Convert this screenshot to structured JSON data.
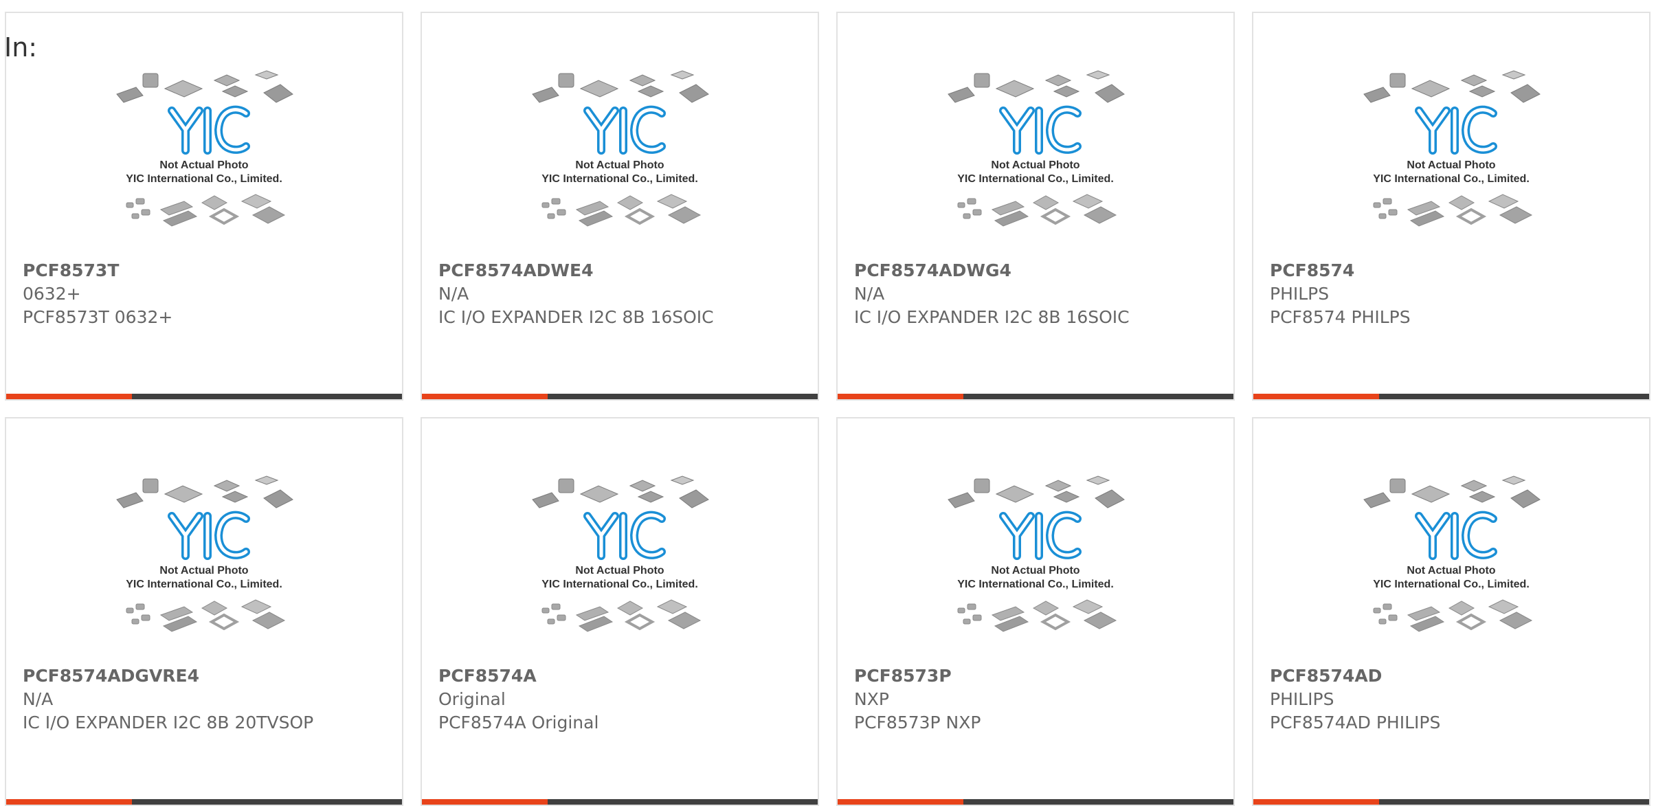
{
  "heading": "In:",
  "colors": {
    "accent": "#e8431a",
    "bar": "#404040",
    "logo": "#1a8fd6",
    "text": "#666666"
  },
  "placeholder": {
    "line1": "Not Actual Photo",
    "line2": "YIC International Co., Limited.",
    "logo_text": "YIC"
  },
  "products": [
    {
      "part": "PCF8573T",
      "brand": "0632+",
      "desc": "PCF8573T 0632+"
    },
    {
      "part": "PCF8574ADWE4",
      "brand": "N/A",
      "desc": "IC I/O EXPANDER I2C 8B 16SOIC"
    },
    {
      "part": "PCF8574ADWG4",
      "brand": "N/A",
      "desc": "IC I/O EXPANDER I2C 8B 16SOIC"
    },
    {
      "part": "PCF8574",
      "brand": "PHILPS",
      "desc": "PCF8574 PHILPS"
    },
    {
      "part": "PCF8574ADGVRE4",
      "brand": "N/A",
      "desc": "IC I/O EXPANDER I2C 8B 20TVSOP"
    },
    {
      "part": "PCF8574A",
      "brand": "Original",
      "desc": "PCF8574A Original"
    },
    {
      "part": "PCF8573P",
      "brand": "NXP",
      "desc": "PCF8573P NXP"
    },
    {
      "part": "PCF8574AD",
      "brand": "PHILIPS",
      "desc": "PCF8574AD PHILIPS"
    }
  ]
}
